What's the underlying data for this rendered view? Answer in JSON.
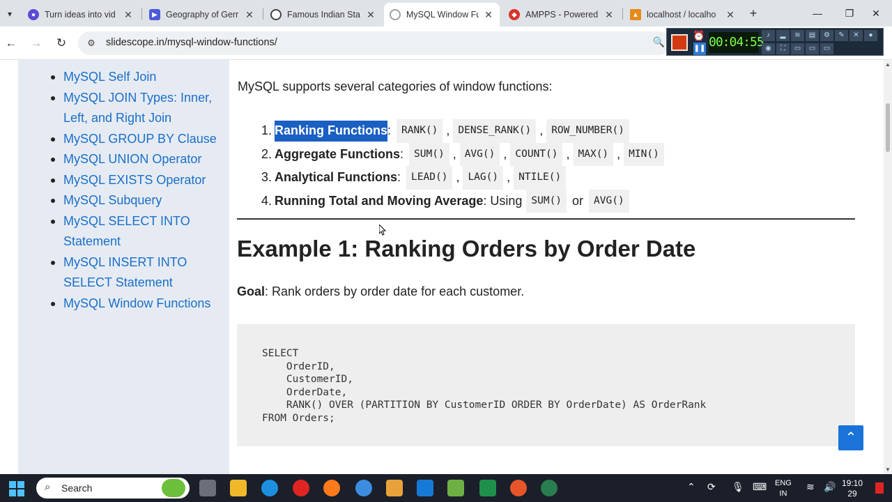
{
  "browser": {
    "tabs": [
      {
        "title": "Turn ideas into vid",
        "color": "#5b4bd6"
      },
      {
        "title": "Geography of Gerr",
        "color": "#4d5bd8"
      },
      {
        "title": "Famous Indian Sta",
        "color": "#444444"
      },
      {
        "title": "MySQL Window Fu",
        "color": "#9aa0a6"
      },
      {
        "title": "AMPPS - Powered",
        "color": "#d8342c"
      },
      {
        "title": "localhost / localho",
        "color": "#e68a1a"
      }
    ],
    "url": "slidescope.in/mysql-window-functions/"
  },
  "recorder": {
    "time": "00:04:55"
  },
  "sidebar": {
    "items": [
      "MySQL Self Join",
      "MySQL JOIN Types: Inner, Left, and Right Join",
      "MySQL GROUP BY Clause",
      "MySQL UNION Operator",
      "MySQL EXISTS Operator",
      "MySQL Subquery",
      "MySQL SELECT INTO Statement",
      "MySQL INSERT INTO SELECT Statement",
      "MySQL Window Functions"
    ]
  },
  "content": {
    "intro": "MySQL supports several categories of window functions:",
    "categories": [
      {
        "num": "1.",
        "name": "Ranking Functions",
        "sep": ":",
        "chips": [
          "RANK()",
          "DENSE_RANK()",
          "ROW_NUMBER()"
        ]
      },
      {
        "num": "2.",
        "name": "Aggregate Functions",
        "sep": ":",
        "chips": [
          "SUM()",
          "AVG()",
          "COUNT()",
          "MAX()",
          "MIN()"
        ]
      },
      {
        "num": "3.",
        "name": "Analytical Functions",
        "sep": ":",
        "chips": [
          "LEAD()",
          "LAG()",
          "NTILE()"
        ]
      },
      {
        "num": "4.",
        "name": "Running Total and Moving Average",
        "sep": ": Using",
        "chips": [
          "SUM()",
          "AVG()"
        ],
        "joiner": "or"
      }
    ],
    "example_heading": "Example 1: Ranking Orders by Order Date",
    "goal_label": "Goal",
    "goal_text": ": Rank orders by order date for each customer.",
    "code": "SELECT\n    OrderID,\n    CustomerID,\n    OrderDate,\n    RANK() OVER (PARTITION BY CustomerID ORDER BY OrderDate) AS OrderRank\nFROM Orders;"
  },
  "taskbar": {
    "search_label": "Search",
    "language": "ENG",
    "region": "IN",
    "time": "19:10",
    "date": "29"
  }
}
